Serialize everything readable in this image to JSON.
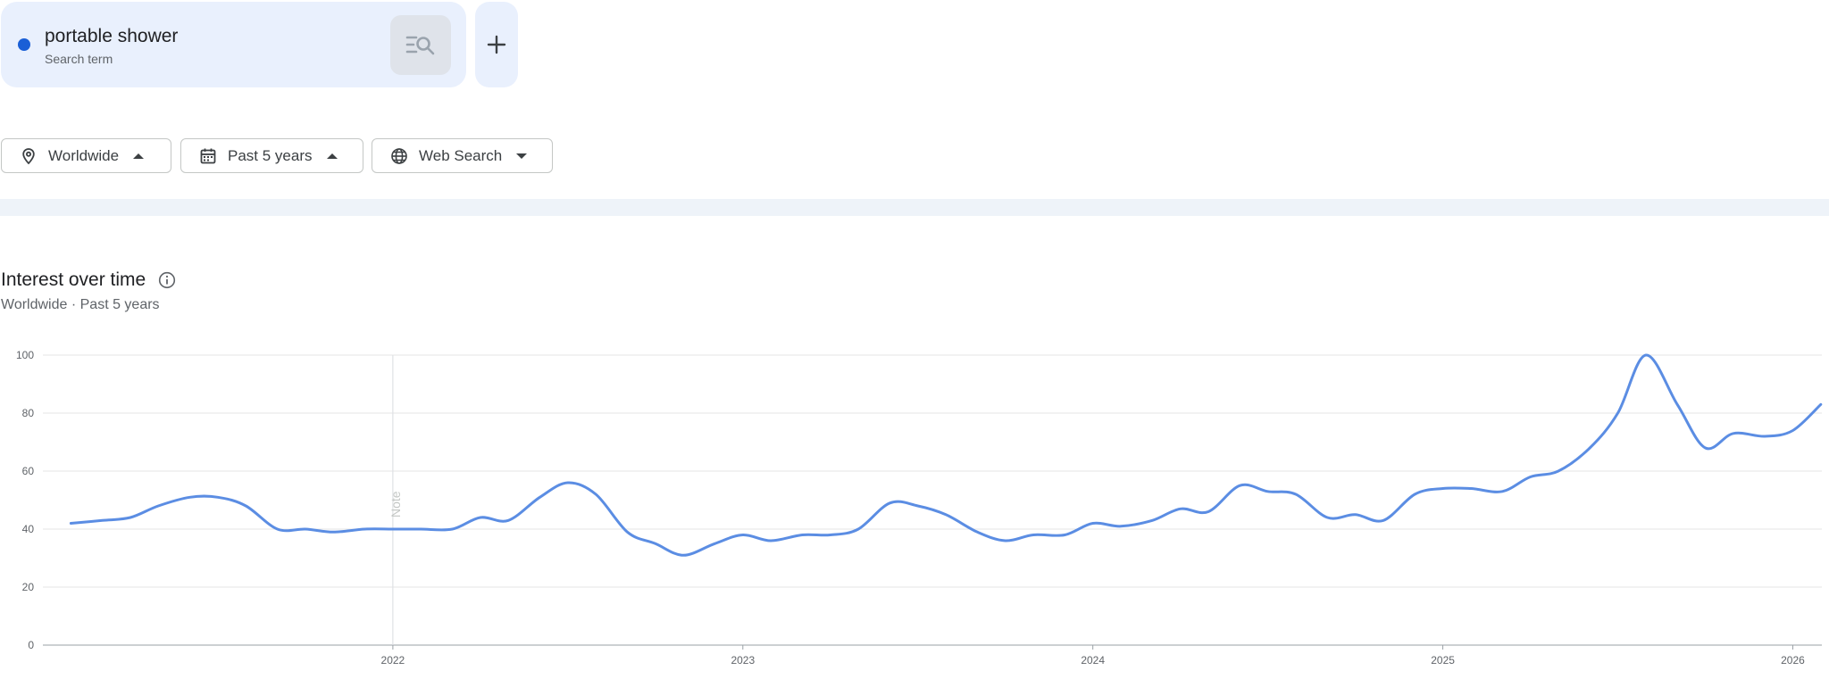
{
  "search_term": {
    "name": "portable shower",
    "type_label": "Search term",
    "color": "#1a5fd6"
  },
  "add_term": {
    "label": "+"
  },
  "filters": {
    "region": {
      "label": "Worldwide",
      "icon": "location-pin-icon"
    },
    "time": {
      "label": "Past 5 years",
      "icon": "calendar-icon"
    },
    "property": {
      "label": "Web Search",
      "icon": "globe-icon"
    }
  },
  "section": {
    "title": "Interest over time",
    "subtitle": "Worldwide · Past 5 years"
  },
  "chart_data": {
    "type": "line",
    "ylim": [
      0,
      100
    ],
    "y_ticks": [
      0,
      20,
      40,
      60,
      80,
      100
    ],
    "x_tick_labels": [
      "2022",
      "2023",
      "2024",
      "2025",
      "2026"
    ],
    "grid": true,
    "annotation": {
      "label": "Note",
      "x": 2022.0
    },
    "series": [
      {
        "color": "#5b8de3",
        "x": [
          2021.08,
          2021.17,
          2021.25,
          2021.33,
          2021.42,
          2021.5,
          2021.58,
          2021.67,
          2021.75,
          2021.83,
          2021.92,
          2022.0,
          2022.08,
          2022.17,
          2022.25,
          2022.33,
          2022.42,
          2022.5,
          2022.58,
          2022.67,
          2022.75,
          2022.83,
          2022.92,
          2023.0,
          2023.08,
          2023.17,
          2023.25,
          2023.33,
          2023.42,
          2023.5,
          2023.58,
          2023.67,
          2023.75,
          2023.83,
          2023.92,
          2024.0,
          2024.08,
          2024.17,
          2024.25,
          2024.33,
          2024.42,
          2024.5,
          2024.58,
          2024.67,
          2024.75,
          2024.83,
          2024.92,
          2025.0,
          2025.08,
          2025.17,
          2025.25,
          2025.33,
          2025.42,
          2025.5,
          2025.58,
          2025.67,
          2025.75,
          2025.83,
          2025.92,
          2026.0,
          2026.08
        ],
        "y": [
          42,
          43,
          44,
          48,
          51,
          51,
          48,
          40,
          40,
          39,
          40,
          40,
          40,
          40,
          44,
          43,
          51,
          56,
          52,
          39,
          35,
          31,
          35,
          38,
          36,
          38,
          38,
          40,
          49,
          48,
          45,
          39,
          36,
          38,
          38,
          42,
          41,
          43,
          47,
          46,
          55,
          53,
          52,
          44,
          45,
          43,
          52,
          54,
          54,
          53,
          58,
          60,
          68,
          80,
          100,
          83,
          68,
          73,
          72,
          74,
          83
        ]
      }
    ]
  }
}
